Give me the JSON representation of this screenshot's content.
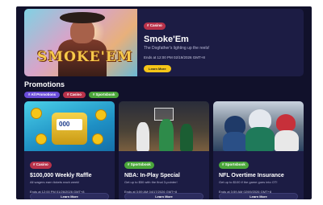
{
  "featured": {
    "tag": "# Casino",
    "title": "Smoke'Em",
    "subtitle": "The Dogfather's lighting up the reels!",
    "ends": "Ends at 12:00 PM 02/19/2026 GMT+8",
    "button": "Learn More",
    "art_logo": "SMOKE'EM"
  },
  "promotions": {
    "title": "Promotions",
    "filters": [
      "# All Promotions",
      "# Casino",
      "# Sportsbook"
    ]
  },
  "cards": [
    {
      "tag": "# Casino",
      "title": "$100,000 Weekly Raffle",
      "subtitle": "All wagers earn tickets each week!",
      "ends": "Ends at 12:00 PM 01/26/2026 GMT+8",
      "button": "Learn More",
      "art_text": "000"
    },
    {
      "tag": "# Sportsbook",
      "title": "NBA: In-Play Special",
      "subtitle": "Get up to $50 with the final 3-pointer!",
      "ends": "Ends at 3:59 AM 04/17/2026 GMT+8",
      "button": "Learn More"
    },
    {
      "tag": "# Sportsbook",
      "title": "NFL Overtime Insurance",
      "subtitle": "Get up to $100 if the game goes into OT!",
      "ends": "Ends at 3:59 AM 02/09/2026 GMT+8",
      "button": "Learn More"
    }
  ],
  "colors": {
    "background": "#11112b",
    "card": "#1c1c44",
    "casino": "#b8324a",
    "sportsbook": "#4aa63a",
    "all": "#6a4cd9",
    "cta": "#f5c518"
  }
}
